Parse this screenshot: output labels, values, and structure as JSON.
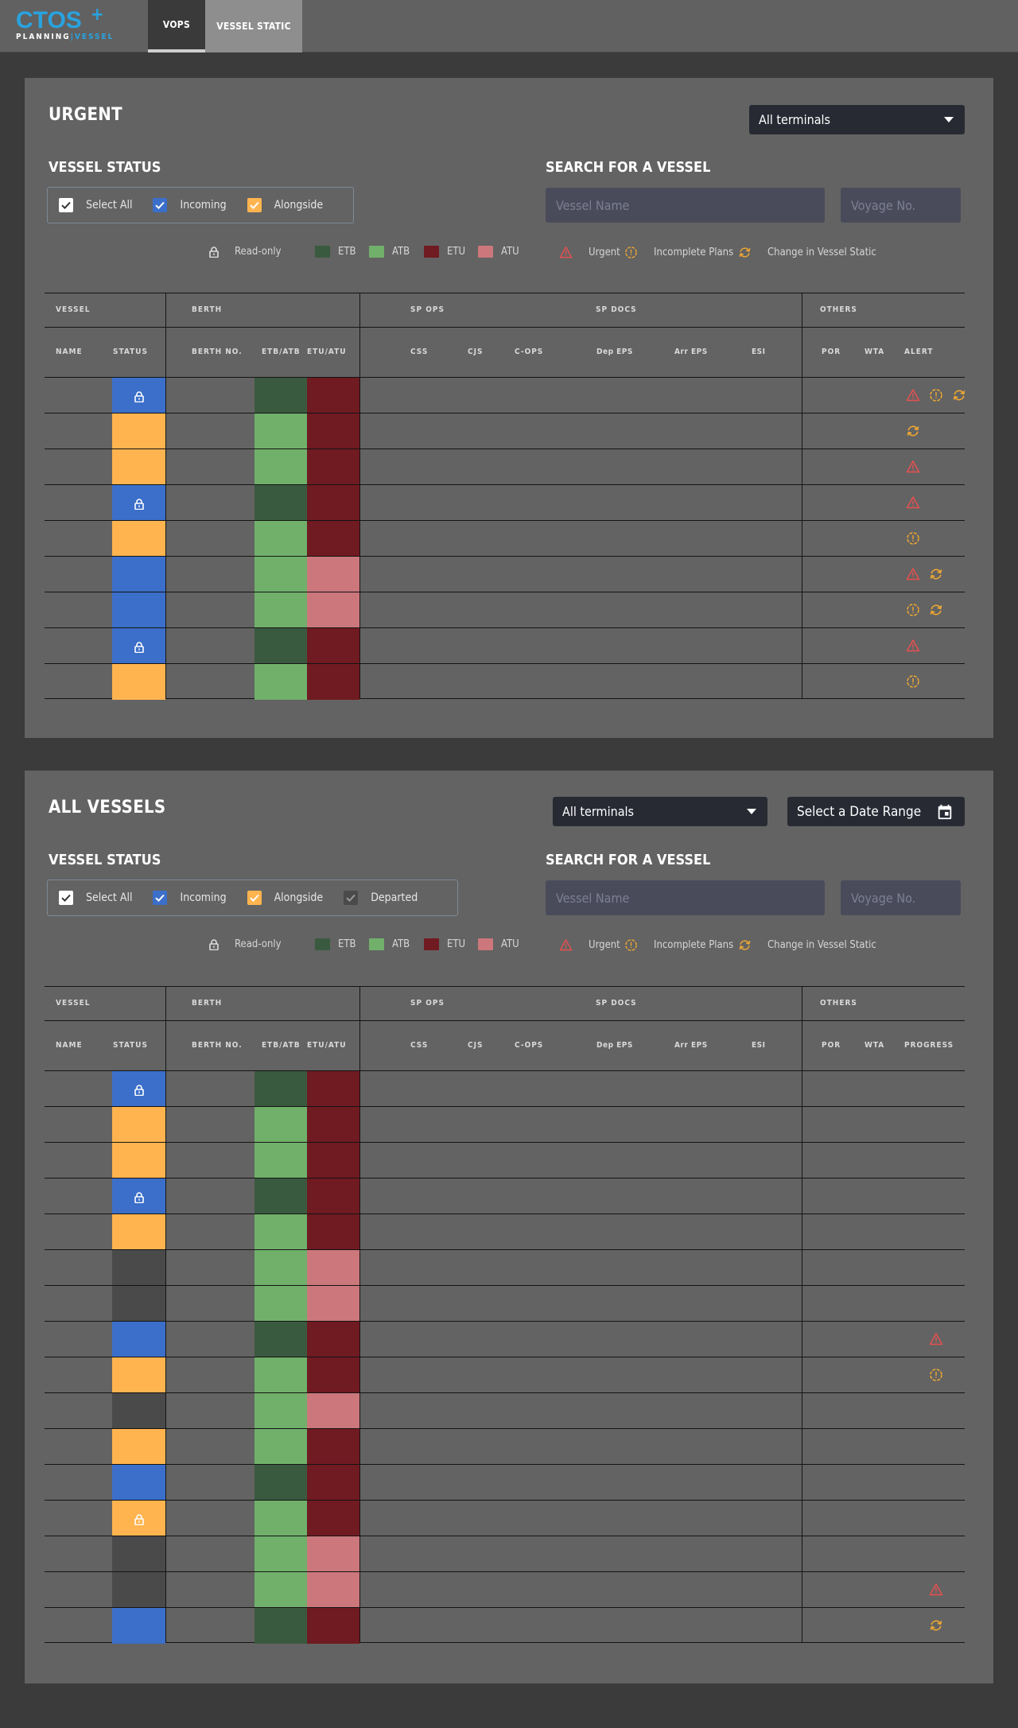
{
  "app": {
    "logo_main": "CTOS",
    "logo_sub_a": "PLANNING",
    "logo_sub_b": "VESSEL",
    "nav": [
      {
        "label": "VOPS",
        "active": true
      },
      {
        "label": "VESSEL STATIC",
        "active": false
      }
    ]
  },
  "colors": {
    "incoming": "#3b6fc9",
    "alongside": "#ffb44f",
    "departed": "#4a4a4a",
    "etb": "#3a5a40",
    "atb": "#70b06b",
    "etu": "#701a21",
    "atu": "#cb777b",
    "urgent": "#e75050",
    "incomplete": "#f0a832",
    "change": "#f0a832"
  },
  "urgent": {
    "title": "URGENT",
    "terminal_select": "All terminals",
    "vessel_status_label": "VESSEL STATUS",
    "checkboxes": [
      {
        "label": "Select All",
        "color": "#ffffff",
        "checked": true
      },
      {
        "label": "Incoming",
        "color": "#3b6fc9",
        "checked": true
      },
      {
        "label": "Alongside",
        "color": "#ffb44f",
        "checked": true
      }
    ],
    "search_label": "SEARCH FOR A VESSEL",
    "vessel_name_placeholder": "Vessel Name",
    "voyage_placeholder": "Voyage No.",
    "legend": {
      "readonly": "Read-only",
      "etb": "ETB",
      "atb": "ATB",
      "etu": "ETU",
      "atu": "ATU",
      "urgent": "Urgent",
      "incomplete": "Incomplete Plans",
      "change": "Change in Vessel Static"
    },
    "groups": {
      "vessel": "VESSEL",
      "berth": "BERTH",
      "spops": "SP OPS",
      "spdocs": "SP DOCS",
      "others": "OTHERS"
    },
    "columns": {
      "name": "NAME",
      "status": "STATUS",
      "berth_no": "BERTH NO.",
      "etb_atb": "ETB/ATB",
      "etu_atu": "ETU/ATU",
      "css": "CSS",
      "cjs": "CJS",
      "cops": "C-OPS",
      "dep_eps": "Dep EPS",
      "arr_eps": "Arr EPS",
      "esi": "ESI",
      "por": "POR",
      "wta": "WTA",
      "last": "ALERT"
    },
    "rows": [
      {
        "status": "incoming",
        "lock": true,
        "berth": "etb",
        "unberth": "etu",
        "alerts": [
          "urgent",
          "incomplete",
          "change"
        ]
      },
      {
        "status": "alongside",
        "lock": false,
        "berth": "atb",
        "unberth": "etu",
        "alerts": [
          "change"
        ]
      },
      {
        "status": "alongside",
        "lock": false,
        "berth": "atb",
        "unberth": "etu",
        "alerts": [
          "urgent"
        ]
      },
      {
        "status": "incoming",
        "lock": true,
        "berth": "etb",
        "unberth": "etu",
        "alerts": [
          "urgent"
        ]
      },
      {
        "status": "alongside",
        "lock": false,
        "berth": "atb",
        "unberth": "etu",
        "alerts": [
          "incomplete"
        ]
      },
      {
        "status": "incoming",
        "lock": false,
        "berth": "atb",
        "unberth": "atu",
        "alerts": [
          "urgent",
          "change"
        ]
      },
      {
        "status": "incoming",
        "lock": false,
        "berth": "atb",
        "unberth": "atu",
        "alerts": [
          "incomplete",
          "change"
        ]
      },
      {
        "status": "incoming",
        "lock": true,
        "berth": "etb",
        "unberth": "etu",
        "alerts": [
          "urgent"
        ]
      },
      {
        "status": "alongside",
        "lock": false,
        "berth": "atb",
        "unberth": "etu",
        "alerts": [
          "incomplete"
        ]
      }
    ]
  },
  "all_vessels": {
    "title": "ALL VESSELS",
    "terminal_select": "All terminals",
    "date_range": "Select a Date Range",
    "vessel_status_label": "VESSEL STATUS",
    "checkboxes": [
      {
        "label": "Select All",
        "color": "#ffffff",
        "checked": true
      },
      {
        "label": "Incoming",
        "color": "#3b6fc9",
        "checked": true
      },
      {
        "label": "Alongside",
        "color": "#ffb44f",
        "checked": true
      },
      {
        "label": "Departed",
        "color": "#4a4a4a",
        "checked": true
      }
    ],
    "search_label": "SEARCH FOR A VESSEL",
    "vessel_name_placeholder": "Vessel Name",
    "voyage_placeholder": "Voyage No.",
    "legend": {
      "readonly": "Read-only",
      "etb": "ETB",
      "atb": "ATB",
      "etu": "ETU",
      "atu": "ATU",
      "urgent": "Urgent",
      "incomplete": "Incomplete Plans",
      "change": "Change in Vessel Static"
    },
    "groups": {
      "vessel": "VESSEL",
      "berth": "BERTH",
      "spops": "SP OPS",
      "spdocs": "SP DOCS",
      "others": "OTHERS"
    },
    "columns": {
      "name": "NAME",
      "status": "STATUS",
      "berth_no": "BERTH NO.",
      "etb_atb": "ETB/ATB",
      "etu_atu": "ETU/ATU",
      "css": "CSS",
      "cjs": "CJS",
      "cops": "C-OPS",
      "dep_eps": "Dep EPS",
      "arr_eps": "Arr EPS",
      "esi": "ESI",
      "por": "POR",
      "wta": "WTA",
      "last": "PROGRESS"
    },
    "rows": [
      {
        "status": "incoming",
        "lock": true,
        "berth": "etb",
        "unberth": "etu",
        "alerts": []
      },
      {
        "status": "alongside",
        "lock": false,
        "berth": "atb",
        "unberth": "etu",
        "alerts": []
      },
      {
        "status": "alongside",
        "lock": false,
        "berth": "atb",
        "unberth": "etu",
        "alerts": []
      },
      {
        "status": "incoming",
        "lock": true,
        "berth": "etb",
        "unberth": "etu",
        "alerts": []
      },
      {
        "status": "alongside",
        "lock": false,
        "berth": "atb",
        "unberth": "etu",
        "alerts": []
      },
      {
        "status": "departed",
        "lock": false,
        "berth": "atb",
        "unberth": "atu",
        "alerts": []
      },
      {
        "status": "departed",
        "lock": false,
        "berth": "atb",
        "unberth": "atu",
        "alerts": []
      },
      {
        "status": "incoming",
        "lock": false,
        "berth": "etb",
        "unberth": "etu",
        "alerts": [
          "urgent"
        ]
      },
      {
        "status": "alongside",
        "lock": false,
        "berth": "atb",
        "unberth": "etu",
        "alerts": [
          "incomplete"
        ]
      },
      {
        "status": "departed",
        "lock": false,
        "berth": "atb",
        "unberth": "atu",
        "alerts": []
      },
      {
        "status": "alongside",
        "lock": false,
        "berth": "atb",
        "unberth": "etu",
        "alerts": []
      },
      {
        "status": "incoming",
        "lock": false,
        "berth": "etb",
        "unberth": "etu",
        "alerts": []
      },
      {
        "status": "alongside",
        "lock": true,
        "berth": "atb",
        "unberth": "etu",
        "alerts": []
      },
      {
        "status": "departed",
        "lock": false,
        "berth": "atb",
        "unberth": "atu",
        "alerts": []
      },
      {
        "status": "departed",
        "lock": false,
        "berth": "atb",
        "unberth": "atu",
        "alerts": [
          "urgent"
        ]
      },
      {
        "status": "incoming",
        "lock": false,
        "berth": "etb",
        "unberth": "etu",
        "alerts": [
          "change"
        ]
      }
    ]
  }
}
